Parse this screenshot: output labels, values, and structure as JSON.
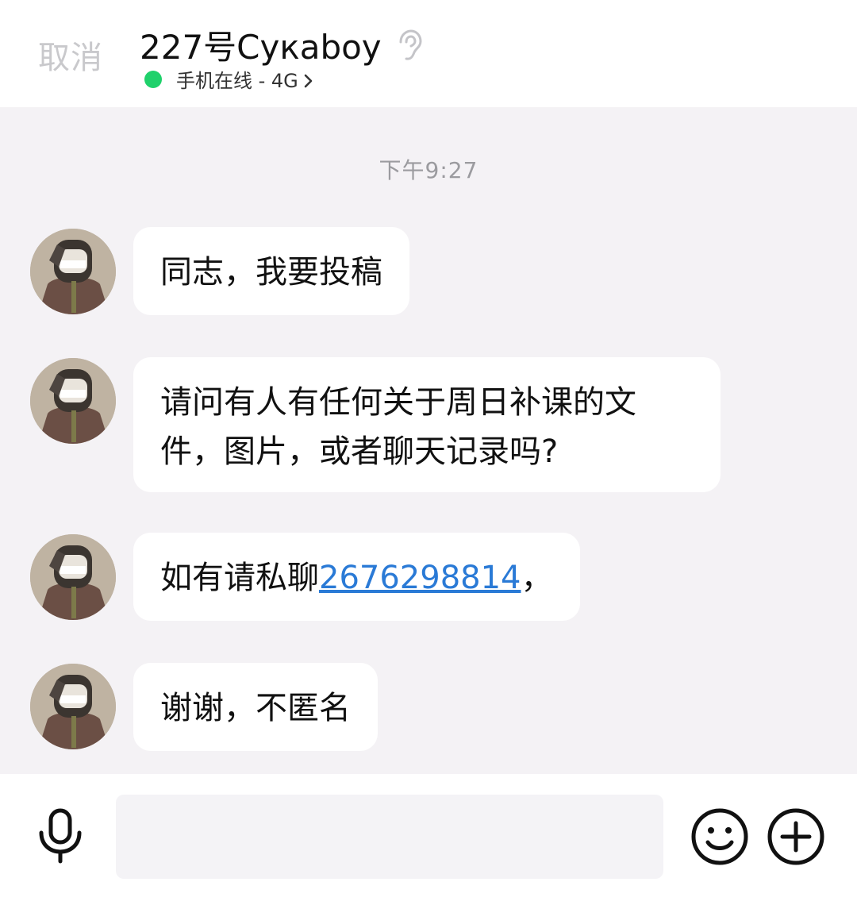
{
  "header": {
    "cancel_label": "取消",
    "title": "227号Cyкaboy",
    "status": "手机在线 - 4G"
  },
  "chat": {
    "timestamp": "下午9:27",
    "messages": [
      {
        "text": "同志，我要投稿"
      },
      {
        "text": "请问有人有任何关于周日补课的文件，图片，或者聊天记录吗?"
      },
      {
        "text_before": "如有请私聊",
        "link": "2676298814",
        "text_after": "，"
      },
      {
        "text": "谢谢，不匿名"
      }
    ]
  },
  "input_bar": {
    "placeholder": ""
  },
  "colors": {
    "online_dot": "#1fd16b",
    "link": "#2a7ad6",
    "chat_background": "#f4f2f5"
  },
  "icons": {
    "mic": "microphone-icon",
    "emoji": "smiley-icon",
    "plus": "plus-circle-icon",
    "ear": "ear-icon",
    "chevron": "chevron-right-icon"
  }
}
